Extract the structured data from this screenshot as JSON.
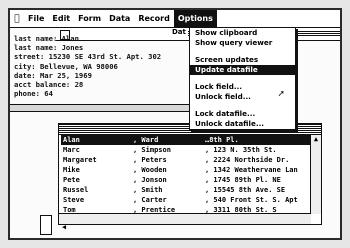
{
  "menubar": {
    "apple": "",
    "items": [
      "File",
      "Edit",
      "Form",
      "Data",
      "Record",
      "Options"
    ]
  },
  "record_window": {
    "title": "Dat",
    "fields": [
      "last name: Alan",
      "last name: Jones",
      "street: 15230 SE 43rd St. Apt. 302",
      "city: Bellevue, WA 98006",
      "date: Mar 25, 1969",
      "acct balance: 28",
      "phone: 64"
    ]
  },
  "list": {
    "rows": [
      [
        "Alan",
        ", Ward",
        "…8th Pl."
      ],
      [
        "Marc",
        ", Simpson",
        ", 123 N. 35th St."
      ],
      [
        "Margaret",
        ", Peters",
        ", 2224 Northside Dr."
      ],
      [
        "Mike",
        ", Wooden",
        ", 1342 Weathervane Lan"
      ],
      [
        "Pete",
        ", Jonson",
        ", 1745 89th Pl. NE"
      ],
      [
        "Russel",
        ", Smith",
        ", 15545 8th Ave. SE"
      ],
      [
        "Steve",
        ", Carter",
        ", 540 Front St. S. Apt"
      ],
      [
        "Tom",
        ", Prentice",
        ", 3311 80th St. S"
      ]
    ],
    "selected_index": 0
  },
  "options_menu": {
    "items": [
      {
        "label": "Show clipboard",
        "highlight": false
      },
      {
        "label": "Show query viewer",
        "highlight": false
      },
      {
        "label": "",
        "gap": true
      },
      {
        "label": "Screen updates",
        "highlight": false
      },
      {
        "label": "Update datafile",
        "highlight": true
      },
      {
        "label": "",
        "gap": true
      },
      {
        "label": "Lock field...",
        "highlight": false
      },
      {
        "label": "Unlock field...",
        "highlight": false
      },
      {
        "label": "",
        "gap": true
      },
      {
        "label": "Lock datafile...",
        "highlight": false
      },
      {
        "label": "Unlock datafile...",
        "highlight": false
      }
    ]
  }
}
